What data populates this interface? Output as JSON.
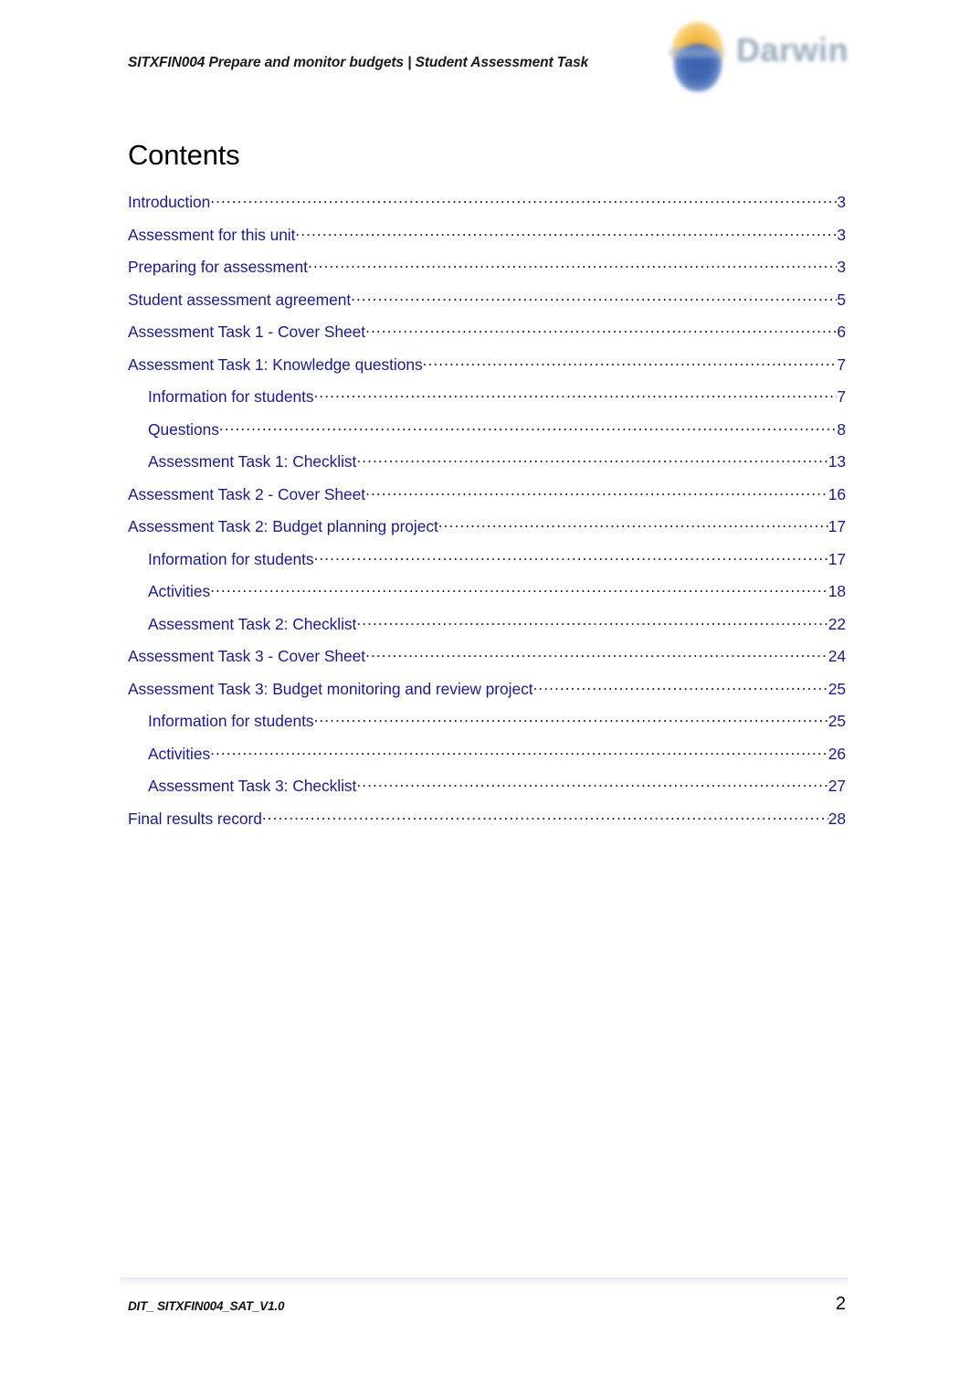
{
  "header": {
    "document_title": "SITXFIN004 Prepare and monitor budgets | Student Assessment Task",
    "logo": {
      "name": "darwin-logo",
      "wordmark": "Darwin",
      "sun_color": "#f0a81e",
      "shield_color": "#345dae",
      "wordmark_color": "#93a6b8"
    }
  },
  "page_title": "Contents",
  "colors": {
    "toc_link": "#1b1b8c",
    "leader_dots": "#1a1a1a",
    "heading": "#000000"
  },
  "toc": {
    "entries": [
      {
        "label": "Introduction",
        "page": "3",
        "level": 1
      },
      {
        "label": "Assessment for this unit",
        "page": "3",
        "level": 1
      },
      {
        "label": "Preparing for assessment",
        "page": "3",
        "level": 1
      },
      {
        "label": "Student assessment agreement",
        "page": "5",
        "level": 1
      },
      {
        "label": "Assessment Task 1 - Cover Sheet",
        "page": "6",
        "level": 1
      },
      {
        "label": "Assessment Task 1: Knowledge questions",
        "page": "7",
        "level": 1
      },
      {
        "label": "Information for students",
        "page": "7",
        "level": 2
      },
      {
        "label": "Questions",
        "page": "8",
        "level": 2
      },
      {
        "label": "Assessment Task 1: Checklist",
        "page": "13",
        "level": 2
      },
      {
        "label": "Assessment Task 2 - Cover Sheet",
        "page": "16",
        "level": 1
      },
      {
        "label": "Assessment Task 2: Budget planning project",
        "page": "17",
        "level": 1
      },
      {
        "label": "Information for students",
        "page": "17",
        "level": 2
      },
      {
        "label": "Activities",
        "page": "18",
        "level": 2
      },
      {
        "label": "Assessment Task 2: Checklist",
        "page": "22",
        "level": 2
      },
      {
        "label": "Assessment Task 3 - Cover Sheet",
        "page": "24",
        "level": 1
      },
      {
        "label": "Assessment Task 3: Budget monitoring and review project",
        "page": "25",
        "level": 1
      },
      {
        "label": "Information for students",
        "page": "25",
        "level": 2
      },
      {
        "label": "Activities",
        "page": "26",
        "level": 2
      },
      {
        "label": "Assessment Task 3: Checklist",
        "page": "27",
        "level": 2
      },
      {
        "label": "Final results record",
        "page": "28",
        "level": 1
      }
    ]
  },
  "footer": {
    "document_code": "DIT_ SITXFIN004_SAT_V1.0",
    "page_number": "2"
  }
}
